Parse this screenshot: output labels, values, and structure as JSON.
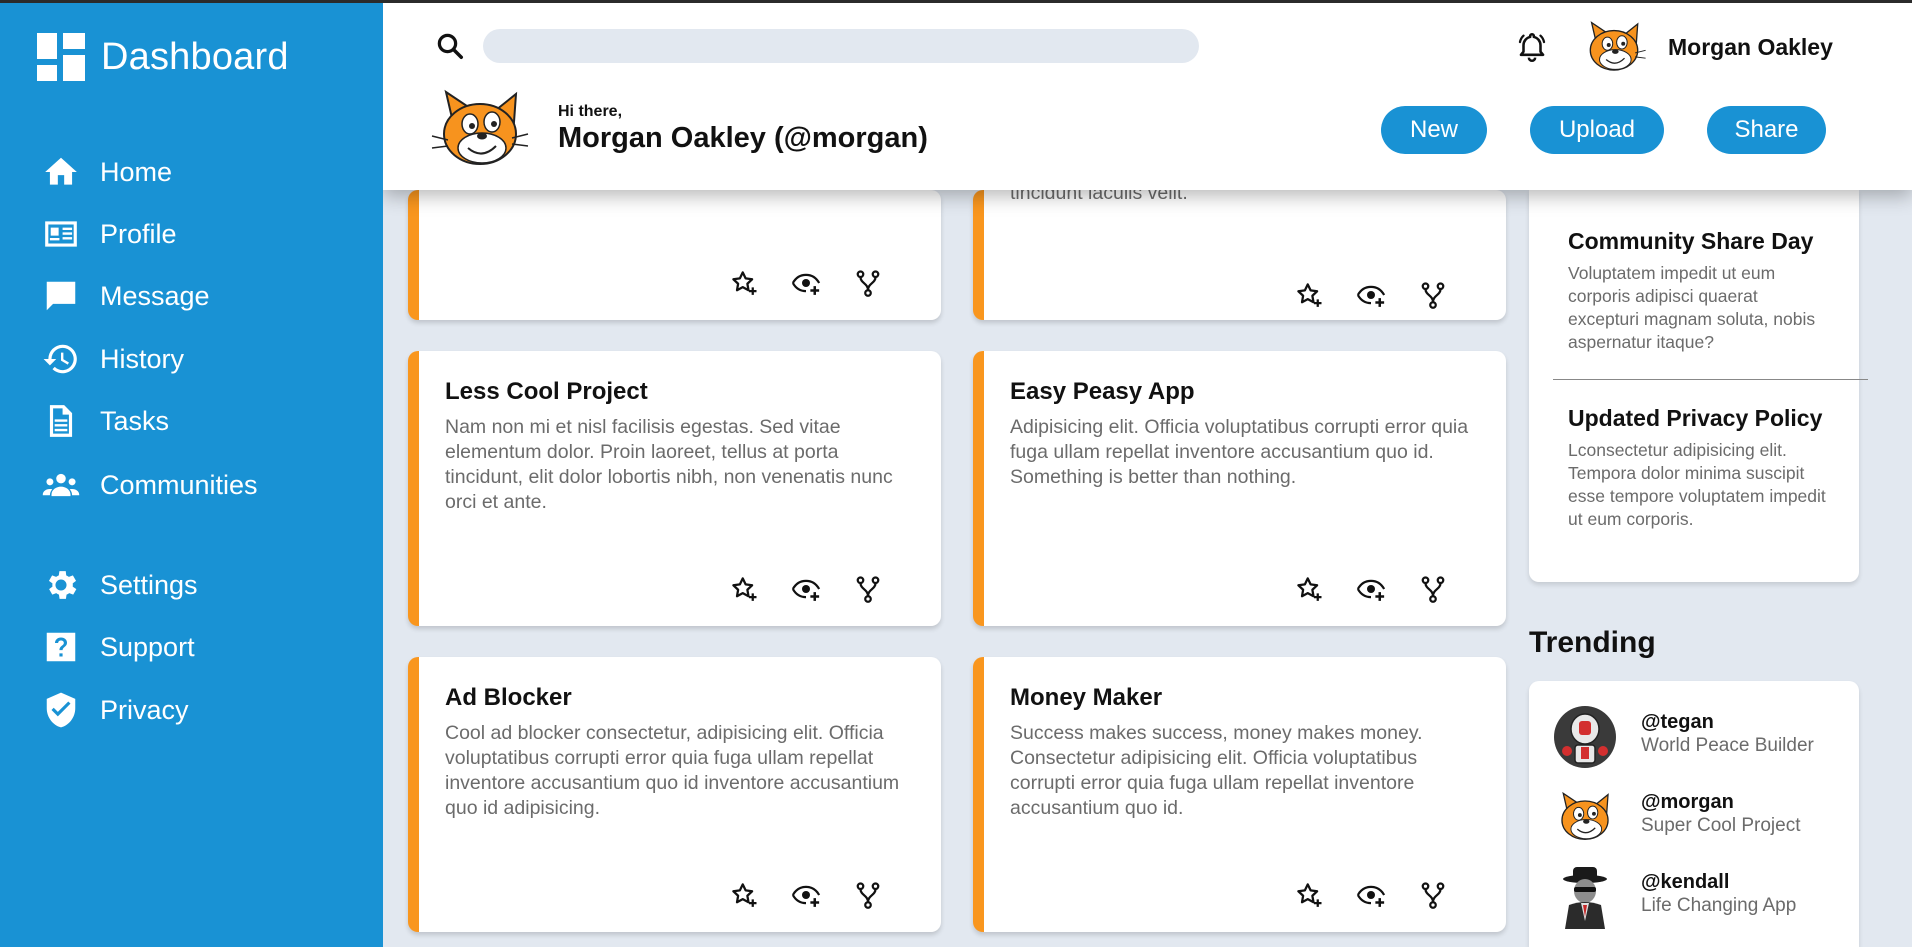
{
  "sidebar": {
    "title": "Dashboard",
    "items": [
      {
        "label": "Home",
        "icon": "home-icon"
      },
      {
        "label": "Profile",
        "icon": "profile-card-icon"
      },
      {
        "label": "Message",
        "icon": "message-icon"
      },
      {
        "label": "History",
        "icon": "history-icon"
      },
      {
        "label": "Tasks",
        "icon": "tasks-icon"
      },
      {
        "label": "Communities",
        "icon": "communities-icon"
      },
      {
        "label": "Settings",
        "icon": "gear-icon"
      },
      {
        "label": "Support",
        "icon": "help-icon"
      },
      {
        "label": "Privacy",
        "icon": "shield-icon"
      }
    ]
  },
  "header": {
    "search": {
      "value": "",
      "placeholder": ""
    },
    "user_name": "Morgan Oakley",
    "greeting": "Hi there,",
    "greeting_name": "Morgan Oakley (@morgan)",
    "buttons": {
      "new": "New",
      "upload": "Upload",
      "share": "Share"
    }
  },
  "projects": [
    {
      "title": "",
      "description": ""
    },
    {
      "title": "",
      "description": "tincidunt iaculis velit."
    },
    {
      "title": "Less Cool Project",
      "description": "Nam non mi et nisl facilisis egestas. Sed vitae elementum dolor. Proin laoreet, tellus at porta tincidunt, elit dolor lobortis nibh, non venenatis nunc orci et ante."
    },
    {
      "title": "Easy Peasy App",
      "description": "Adipisicing elit. Officia voluptatibus corrupti error quia fuga ullam repellat inventore accusantium quo id. Something is better than nothing."
    },
    {
      "title": "Ad Blocker",
      "description": "Cool ad blocker consectetur, adipisicing elit. Officia voluptatibus corrupti error quia fuga ullam repellat inventore accusantium quo id inventore accusantium quo id adipisicing."
    },
    {
      "title": "Money Maker",
      "description": "Success makes success, money makes money. Consectetur adipisicing elit. Officia voluptatibus corrupti error quia fuga ullam repellat inventore accusantium quo id."
    }
  ],
  "announcements": [
    {
      "title": "Community Share Day",
      "text": "Voluptatem impedit ut eum corporis adipisci quaerat excepturi magnam soluta, nobis aspernatur itaque?"
    },
    {
      "title": "Updated Privacy Policy",
      "text": "Lconsectetur adipisicing elit. Tempora dolor minima suscipit esse tempore voluptatem impedit ut eum corporis."
    }
  ],
  "trending": {
    "heading": "Trending",
    "items": [
      {
        "handle": "@tegan",
        "project": "World Peace Builder",
        "avatar": "robot-avatar"
      },
      {
        "handle": "@morgan",
        "project": "Super Cool Project",
        "avatar": "cat-avatar"
      },
      {
        "handle": "@kendall",
        "project": "Life Changing App",
        "avatar": "spy-avatar"
      }
    ]
  },
  "colors": {
    "primary": "#1992d4",
    "accent": "#f9961e",
    "background": "#e2e8f0"
  }
}
